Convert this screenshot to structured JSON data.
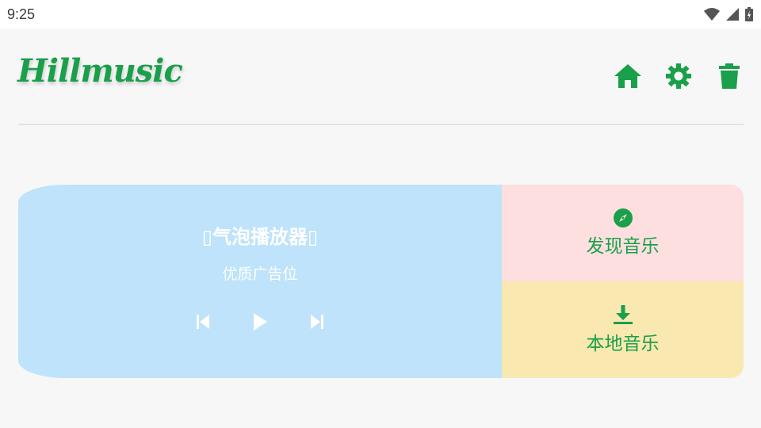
{
  "status_bar": {
    "time": "9:25"
  },
  "header": {
    "logo": "Hillmusic",
    "actions": [
      {
        "icon": "home-icon"
      },
      {
        "icon": "gear-icon"
      },
      {
        "icon": "trash-icon"
      }
    ]
  },
  "player": {
    "title": "▯气泡播放器▯",
    "subtitle": "优质广告位",
    "controls": [
      "skip-previous-icon",
      "play-icon",
      "skip-next-icon"
    ]
  },
  "tiles": {
    "discover": {
      "label": "发现音乐",
      "icon": "compass-icon"
    },
    "local": {
      "label": "本地音乐",
      "icon": "download-icon"
    }
  },
  "colors": {
    "accent": "#1a9f4a",
    "player_bg": "#bee3fb",
    "discover_bg": "#fddfe0",
    "local_bg": "#f9e8b0"
  }
}
